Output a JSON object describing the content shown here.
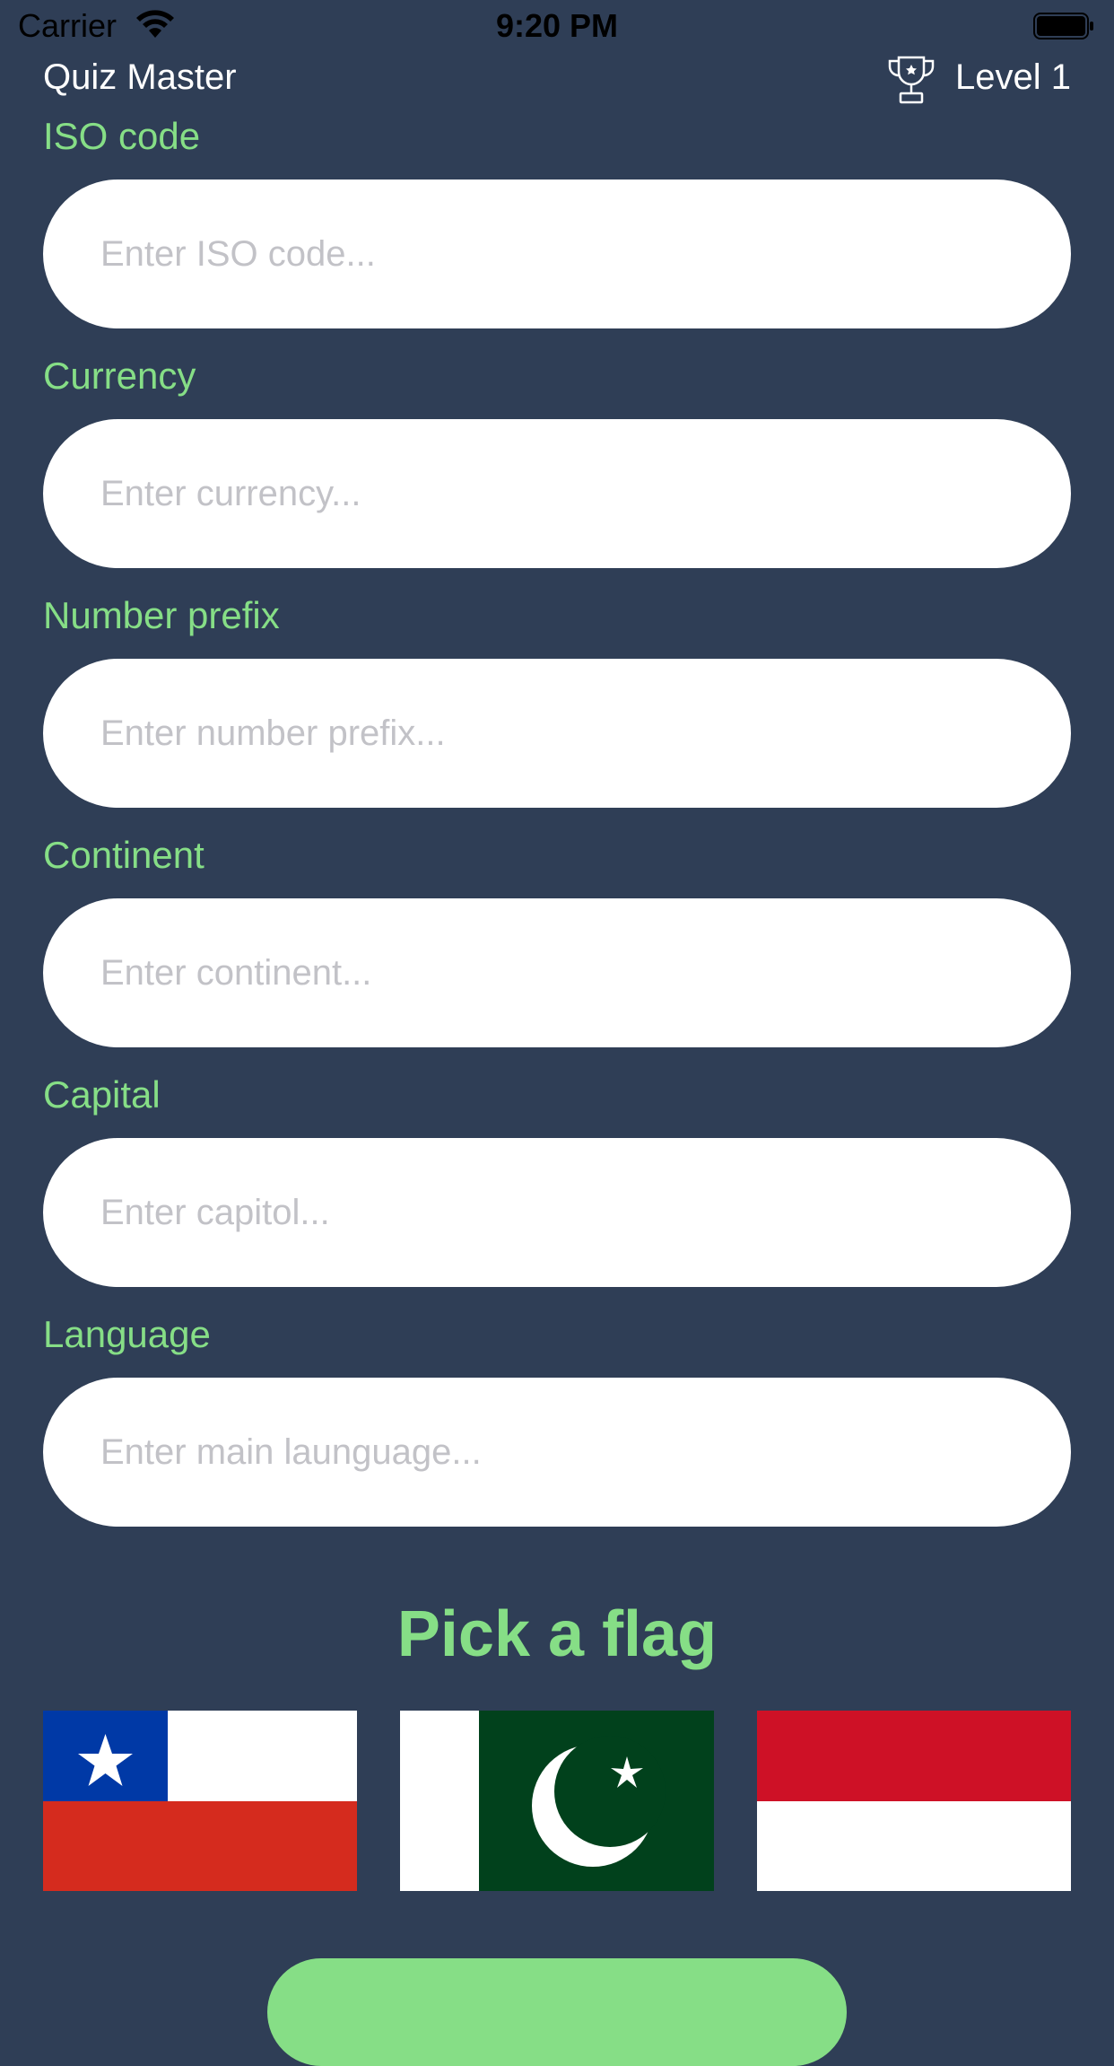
{
  "status_bar": {
    "carrier": "Carrier",
    "time": "9:20 PM"
  },
  "header": {
    "title": "Quiz Master",
    "level": "Level 1"
  },
  "fields": [
    {
      "label": "ISO code",
      "placeholder": "Enter ISO code..."
    },
    {
      "label": "Currency",
      "placeholder": "Enter currency..."
    },
    {
      "label": "Number prefix",
      "placeholder": "Enter number prefix..."
    },
    {
      "label": "Continent",
      "placeholder": "Enter continent..."
    },
    {
      "label": "Capital",
      "placeholder": "Enter capitol..."
    },
    {
      "label": "Language",
      "placeholder": "Enter main launguage..."
    }
  ],
  "pick_flag": {
    "title": "Pick a flag",
    "flags": [
      "chile-flag",
      "pakistan-flag",
      "indonesia-flag"
    ]
  },
  "colors": {
    "background": "#2f3e56",
    "accent": "#86de86",
    "input_background": "#ffffff",
    "placeholder": "#c2c2c7"
  }
}
